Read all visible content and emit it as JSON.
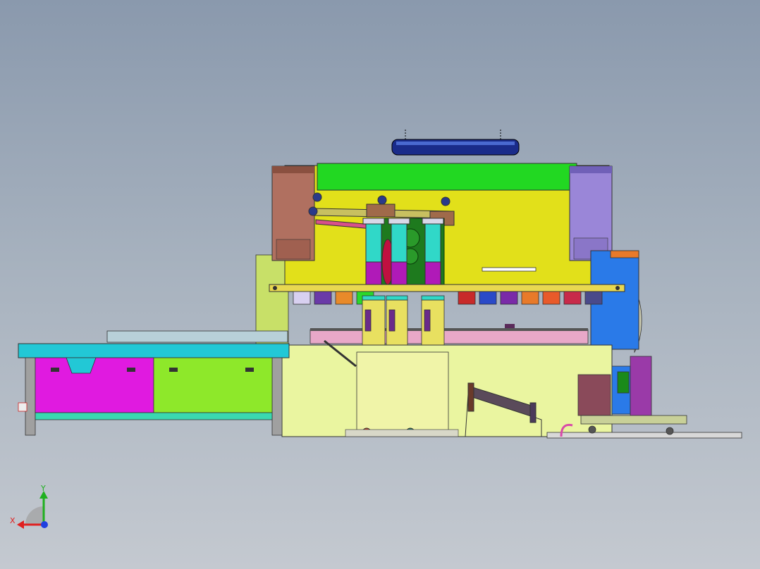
{
  "viewport": {
    "background_top": "#8a99ad",
    "background_bottom": "#c4c9d0",
    "model_description_icon": "press-brake-assembly"
  },
  "triad": {
    "x_label": "X",
    "y_label": "Y",
    "x_color": "#e02020",
    "y_color": "#20b020",
    "z_color": "#2040e0"
  },
  "palette": {
    "frame_yellow": "#e2e01a",
    "beam_green": "#22d822",
    "left_side_brown": "#b07060",
    "right_side_purple": "#9a86d8",
    "table_cyan": "#22c8d6",
    "cabinet_magenta": "#e01ae0",
    "cabinet_lime": "#8ee82a",
    "base_pale": "#eaf5a0",
    "cylinder_magenta": "#b01ab8",
    "cylinder_cyan": "#30d8c8",
    "blue_unit": "#2a7ae8"
  }
}
